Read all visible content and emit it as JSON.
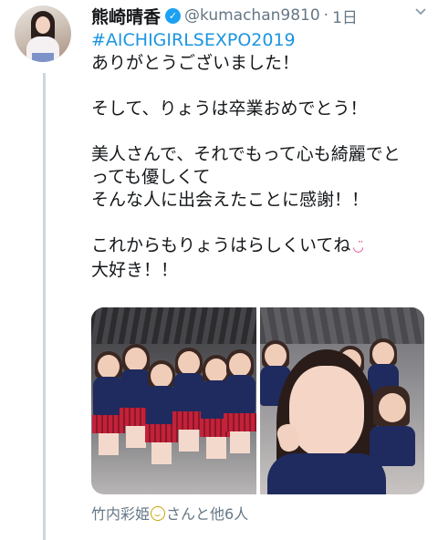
{
  "tweet": {
    "display_name": "熊崎晴香",
    "handle": "@kumachan9810",
    "separator": "·",
    "time": "1日",
    "hashtag": "#AICHIGIRLSEXPO2019",
    "lines": [
      "ありがとうございました！",
      "",
      "そして、りょうは卒業おめでとう！",
      "",
      "美人さんで、それでもって心も綺麗でと",
      "っても優しくて",
      "そんな人に出会えたことに感謝！！",
      "",
      "これからもりょうはらしくいてね",
      "大好き！！"
    ],
    "emoji_after_line_9": "◡̈",
    "tagged_name": "竹内彩姫",
    "tagged_suffix": "さんと他6人"
  },
  "icons": {
    "verified": "verified-badge-icon",
    "menu": "chevron-down-icon",
    "tag_emoji": "smiley-icon"
  },
  "colors": {
    "link": "#1b95e0",
    "verified": "#1da1f2",
    "secondary_text": "#657786"
  }
}
